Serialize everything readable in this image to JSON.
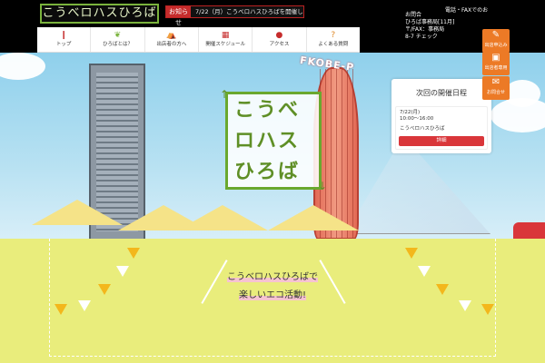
{
  "header": {
    "logo_text": "こうべロハスひろば",
    "news_label": "お知らせ",
    "news_text": "7/22（月）こうべロハスひろばを開催します！",
    "fax": "電話・FAXでのお",
    "right_lines": [
      "お問合",
      "ひろば事務局[11月]",
      "〒/FAX：事務局",
      "8-7 チェック"
    ]
  },
  "nav": {
    "items": [
      {
        "label": "トップ",
        "icon": "pin-icon",
        "glyph": "❙",
        "color": "#c62c2c"
      },
      {
        "label": "ひろばとは？",
        "icon": "leaf-icon",
        "glyph": "❦",
        "color": "#7ab33c"
      },
      {
        "label": "出店者の方へ",
        "icon": "tent-icon",
        "glyph": "⛺",
        "color": "#c62c2c"
      },
      {
        "label": "開催スケジュール",
        "icon": "calendar-icon",
        "glyph": "▦",
        "color": "#c62c2c"
      },
      {
        "label": "アクセス",
        "icon": "map-pin-icon",
        "glyph": "●",
        "color": "#c62c2c"
      },
      {
        "label": "よくある質問",
        "icon": "question-icon",
        "glyph": "?",
        "color": "#e08a2a"
      }
    ]
  },
  "hero": {
    "sign_text": "FKOBE-P",
    "logo_lines": [
      "こうべ",
      "ロハス",
      "ひろば"
    ]
  },
  "event": {
    "title": "次回の開催日程",
    "date": "7/22(月)",
    "time": "10:00～16:00",
    "name": "こうべロハスひろば",
    "button": "詳細"
  },
  "side": {
    "buttons": [
      {
        "label": "出店申込み",
        "icon": "pencil-icon",
        "glyph": "✎"
      },
      {
        "label": "出店者専用",
        "icon": "lock-icon",
        "glyph": "▣"
      },
      {
        "label": "お問合せ",
        "icon": "mail-icon",
        "glyph": "✉"
      }
    ]
  },
  "tagline": {
    "line1": "こうべロハスひろばで",
    "line2": "楽しいエコ活動!"
  }
}
